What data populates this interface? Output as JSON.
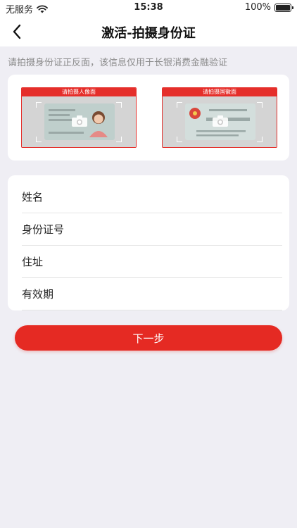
{
  "status_bar": {
    "carrier": "无服务",
    "time": "15:38",
    "battery": "100%"
  },
  "nav": {
    "title": "激活-拍摄身份证",
    "back_icon": "chevron-left-icon"
  },
  "hint": "请拍摄身份证正反面，该信息仅用于长银消费金融验证",
  "id_cards": [
    {
      "label": "请拍摄人像面",
      "icon": "camera-icon"
    },
    {
      "label": "请拍摄国徽面",
      "icon": "camera-icon"
    }
  ],
  "form": {
    "fields": [
      {
        "label": "姓名",
        "value": "",
        "placeholder": ""
      },
      {
        "label": "身份证号",
        "value": "",
        "placeholder": ""
      },
      {
        "label": "住址",
        "value": "",
        "placeholder": ""
      },
      {
        "label": "有效期",
        "value": "",
        "placeholder": ""
      }
    ]
  },
  "next_button": "下一步",
  "colors": {
    "accent": "#e52a23",
    "background": "#efeef4",
    "panel": "#ffffff",
    "hint_text": "#8a8a8a"
  }
}
